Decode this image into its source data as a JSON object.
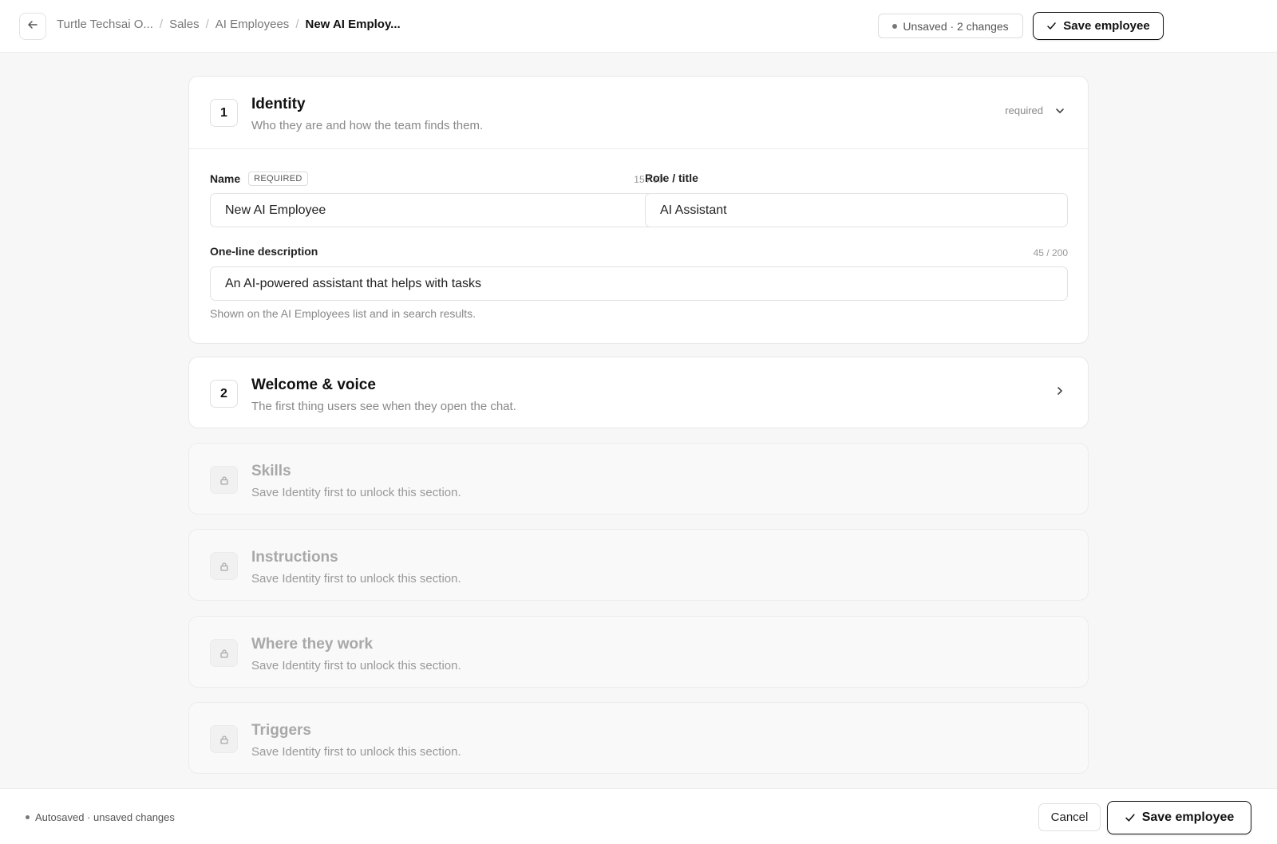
{
  "header": {
    "breadcrumb": [
      "Turtle Techsai O...",
      "Sales",
      "AI Employees"
    ],
    "breadcrumb_current": "New AI Employ...",
    "unsaved_status": "Unsaved · 2 changes",
    "save_label": "Save employee"
  },
  "identity": {
    "step": "1",
    "title": "Identity",
    "subtitle": "Who they are and how the team finds them.",
    "status": "required",
    "name_label": "Name",
    "name_required_tag": "REQUIRED",
    "name_counter": "15 / 60",
    "name_value": "New AI Employee",
    "role_label": "Role / title",
    "role_value": "AI Assistant",
    "desc_label": "One-line description",
    "desc_counter": "45 / 200",
    "desc_value": "An AI-powered assistant that helps with tasks",
    "desc_help": "Shown on the AI Employees list and in search results."
  },
  "welcome": {
    "step": "2",
    "title": "Welcome & voice",
    "subtitle": "The first thing users see when they open the chat."
  },
  "locked_sections": [
    {
      "title": "Skills",
      "subtitle": "Save Identity first to unlock this section."
    },
    {
      "title": "Instructions",
      "subtitle": "Save Identity first to unlock this section."
    },
    {
      "title": "Where they work",
      "subtitle": "Save Identity first to unlock this section."
    },
    {
      "title": "Triggers",
      "subtitle": "Save Identity first to unlock this section."
    }
  ],
  "footer": {
    "autosave_status": "Autosaved · unsaved changes",
    "cancel_label": "Cancel",
    "save_label": "Save employee"
  },
  "icons": {
    "back": "arrow-left-icon",
    "check": "check-icon",
    "expand": "chevron-down-icon",
    "open": "chevron-right-icon",
    "lock": "lock-icon"
  }
}
